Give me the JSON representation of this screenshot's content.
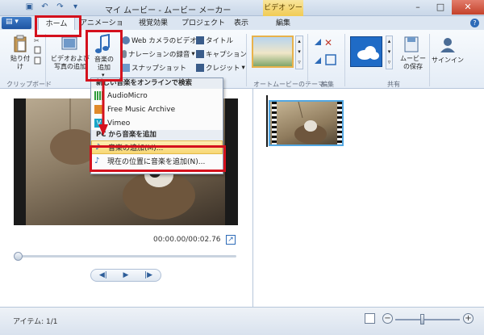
{
  "window": {
    "title": "マイ ムービー - ムービー メーカー",
    "contextual_tab_header": "ビデオ ツール"
  },
  "tabs": [
    "ホーム",
    "アニメーション",
    "視覚効果",
    "プロジェクト",
    "表示",
    "編集"
  ],
  "ribbon": {
    "clipboard": {
      "paste_label": "貼り付け",
      "group_label": "クリップボード"
    },
    "add": {
      "add_video_label": "ビデオおよび写真の追加",
      "add_music_label": "音楽の追加",
      "webcam_label": "Web カメラのビデオ",
      "narration_label": "ナレーションの録音",
      "snapshot_label": "スナップショット",
      "title_label": "タイトル",
      "caption_label": "キャプション",
      "credit_label": "クレジット"
    },
    "automovie": {
      "group_label": "オートムービーのテーマ"
    },
    "editing": {
      "group_label": "編集"
    },
    "share": {
      "save_label": "ムービーの保存",
      "group_label": "共有"
    },
    "signin_label": "サインイン"
  },
  "dropdown": {
    "online_section": "新しい音楽をオンラインで検索",
    "online_items": [
      "AudioMicro",
      "Free Music Archive",
      "Vimeo"
    ],
    "pc_section": "PC から音楽を追加",
    "pc_items": [
      "音楽の追加(M)...",
      "現在の位置に音楽を追加(N)..."
    ]
  },
  "preview": {
    "time": "00:00.00/00:02.76"
  },
  "status": {
    "items_text": "アイテム: 1/1"
  },
  "colors": {
    "highlight_red": "#d4111d",
    "accent_blue": "#2d6bb8",
    "menu_highlight": "#f7d774"
  }
}
